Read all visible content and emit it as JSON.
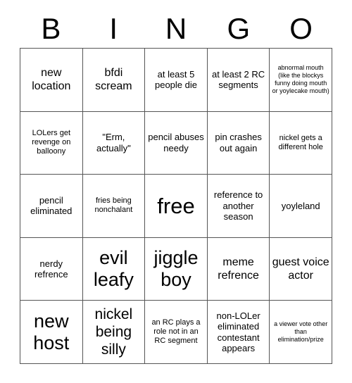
{
  "header": {
    "letters": [
      "B",
      "I",
      "N",
      "G",
      "O"
    ]
  },
  "grid": {
    "rows": [
      [
        {
          "text": "new location",
          "size": "l"
        },
        {
          "text": "bfdi scream",
          "size": "l"
        },
        {
          "text": "at least 5 people die",
          "size": "m"
        },
        {
          "text": "at least 2 RC segments",
          "size": "m"
        },
        {
          "text": "abnormal mouth (like the blockys funny doing mouth or yoylecake mouth)",
          "size": "xs"
        }
      ],
      [
        {
          "text": "LOLers get revenge on balloony",
          "size": "s"
        },
        {
          "text": "\"Erm, actually\"",
          "size": "m"
        },
        {
          "text": "pencil abuses needy",
          "size": "m"
        },
        {
          "text": "pin crashes out again",
          "size": "m"
        },
        {
          "text": "nickel gets a different hole",
          "size": "s"
        }
      ],
      [
        {
          "text": "pencil eliminated",
          "size": "m"
        },
        {
          "text": "fries being nonchalant",
          "size": "s"
        },
        {
          "text": "free",
          "size": "free"
        },
        {
          "text": "reference to another season",
          "size": "m"
        },
        {
          "text": "yoyleland",
          "size": "m"
        }
      ],
      [
        {
          "text": "nerdy refrence",
          "size": "m"
        },
        {
          "text": "evil leafy",
          "size": "xxl"
        },
        {
          "text": "jiggle boy",
          "size": "xxl"
        },
        {
          "text": "meme refrence",
          "size": "l"
        },
        {
          "text": "guest voice actor",
          "size": "l"
        }
      ],
      [
        {
          "text": "new host",
          "size": "xxl"
        },
        {
          "text": "nickel being silly",
          "size": "xl"
        },
        {
          "text": "an RC plays a role not in an RC segment",
          "size": "s"
        },
        {
          "text": "non-LOLer eliminated contestant appears",
          "size": "m"
        },
        {
          "text": "a viewer vote other than elimination/prize",
          "size": "xs"
        }
      ]
    ]
  }
}
